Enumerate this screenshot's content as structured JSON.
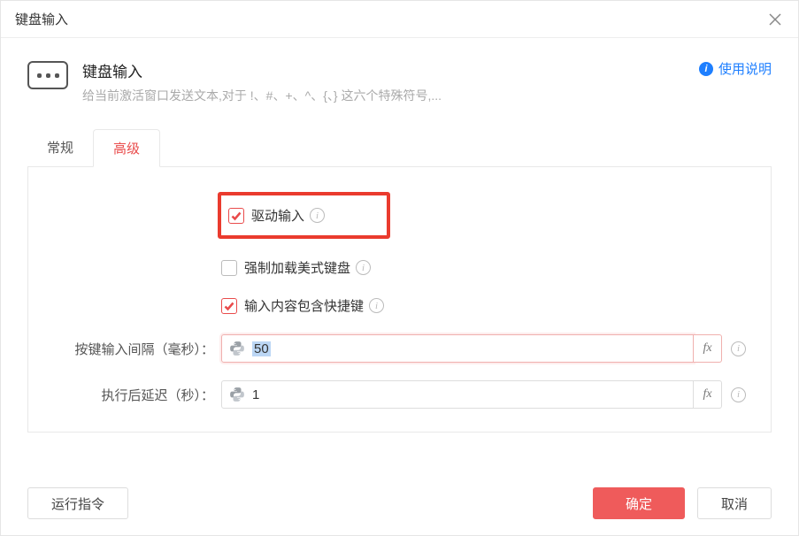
{
  "window": {
    "title": "键盘输入"
  },
  "header": {
    "title": "键盘输入",
    "description": "给当前激活窗口发送文本,对于 !、#、+、^、{、} 这六个特殊符号,...",
    "help_link": "使用说明"
  },
  "tabs": {
    "items": [
      {
        "label": "常规",
        "active": false
      },
      {
        "label": "高级",
        "active": true
      }
    ]
  },
  "options": {
    "driver_input": {
      "label": "驱动输入",
      "checked": true
    },
    "force_us_kb": {
      "label": "强制加载美式键盘",
      "checked": false
    },
    "content_shortcut": {
      "label": "输入内容包含快捷键",
      "checked": true
    }
  },
  "fields": {
    "key_interval": {
      "label": "按键输入间隔（毫秒）：",
      "value": "50",
      "selected": true
    },
    "post_delay": {
      "label": "执行后延迟（秒）：",
      "value": "1",
      "selected": false
    }
  },
  "buttons": {
    "run": "运行指令",
    "ok": "确定",
    "cancel": "取消"
  }
}
